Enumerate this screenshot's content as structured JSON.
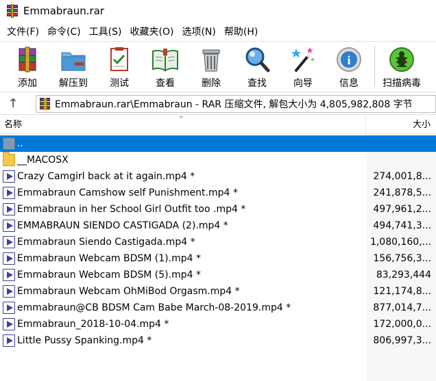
{
  "window": {
    "title": "Emmabraun.rar"
  },
  "menu": [
    "文件(F)",
    "命令(C)",
    "工具(S)",
    "收藏夹(O)",
    "选项(N)",
    "帮助(H)"
  ],
  "toolbar": [
    {
      "label": "添加",
      "icon": "add-archive-icon"
    },
    {
      "label": "解压到",
      "icon": "extract-to-icon"
    },
    {
      "label": "测试",
      "icon": "test-icon"
    },
    {
      "label": "查看",
      "icon": "view-book-icon"
    },
    {
      "label": "删除",
      "icon": "delete-trash-icon"
    },
    {
      "label": "查找",
      "icon": "find-magnifier-icon"
    },
    {
      "label": "向导",
      "icon": "wizard-wand-icon"
    },
    {
      "label": "信息",
      "icon": "info-icon"
    },
    {
      "label": "扫描病毒",
      "icon": "virus-scan-icon"
    }
  ],
  "address": {
    "text": "Emmabraun.rar\\Emmabraun - RAR 压缩文件, 解包大小为 4,805,982,808 字节"
  },
  "columns": {
    "name": "名称",
    "size": "大小"
  },
  "files": [
    {
      "name": "..",
      "size": "",
      "type": "parent",
      "selected": true
    },
    {
      "name": "__MACOSX",
      "size": "",
      "type": "folder"
    },
    {
      "name": "Crazy Camgirl back at it again.mp4 *",
      "size": "274,001,8...",
      "type": "video"
    },
    {
      "name": "Emmabraun Camshow self Punishment.mp4 *",
      "size": "241,878,5...",
      "type": "video"
    },
    {
      "name": "Emmabraun in her School Girl Outfit too .mp4 *",
      "size": "497,961,2...",
      "type": "video"
    },
    {
      "name": "EMMABRAUN SIENDO CASTIGADA (2).mp4 *",
      "size": "494,741,3...",
      "type": "video"
    },
    {
      "name": "Emmabraun Siendo Castigada.mp4 *",
      "size": "1,080,160,...",
      "type": "video"
    },
    {
      "name": "Emmabraun Webcam BDSM (1).mp4 *",
      "size": "156,756,3...",
      "type": "video"
    },
    {
      "name": "Emmabraun Webcam BDSM (5).mp4 *",
      "size": "83,293,444",
      "type": "video"
    },
    {
      "name": "Emmabraun Webcam OhMiBod Orgasm.mp4 *",
      "size": "121,174,8...",
      "type": "video"
    },
    {
      "name": "emmabraun@CB BDSM Cam Babe March-08-2019.mp4 *",
      "size": "877,014,7...",
      "type": "video"
    },
    {
      "name": "Emmabraun_2018-10-04.mp4 *",
      "size": "172,000,0...",
      "type": "video"
    },
    {
      "name": "Little Pussy Spanking.mp4 *",
      "size": "806,997,3...",
      "type": "video"
    }
  ]
}
